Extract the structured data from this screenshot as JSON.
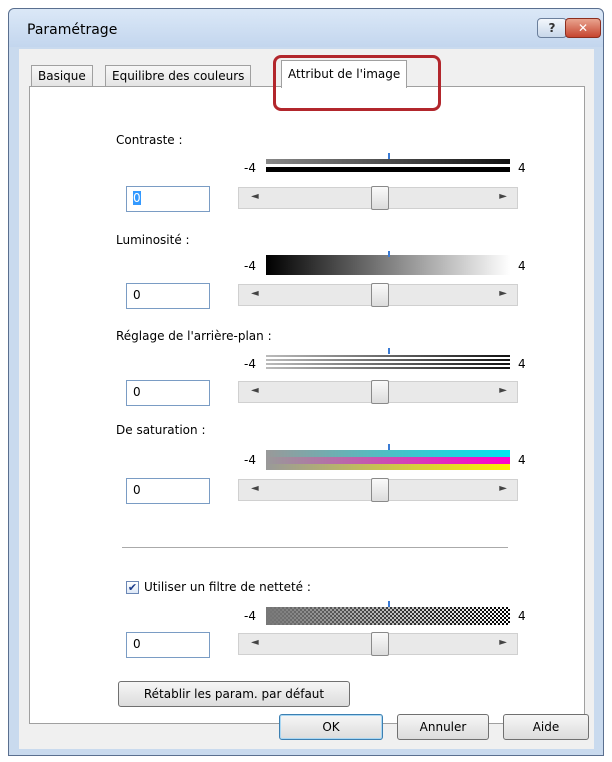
{
  "window": {
    "title": "Paramétrage",
    "help_glyph": "?",
    "close_glyph": "✕"
  },
  "tabs": [
    {
      "label": "Basique"
    },
    {
      "label": "Equilibre des couleurs"
    },
    {
      "label": "Attribut de l'image",
      "active": true
    }
  ],
  "ramp_min": "-4",
  "ramp_max": "4",
  "settings": [
    {
      "label": "Contraste :",
      "value": "0",
      "focused": true
    },
    {
      "label": "Luminosité :",
      "value": "0"
    },
    {
      "label": "Réglage de l'arrière-plan :",
      "value": "0"
    },
    {
      "label": "De saturation :",
      "value": "0"
    },
    {
      "label": "Utiliser un filtre de netteté :",
      "value": "0",
      "checked": true
    }
  ],
  "slider_arrows": {
    "left": "◄",
    "right": "►"
  },
  "check_mark": "✔",
  "reset_button": "Rétablir les param. par défaut",
  "footer": {
    "ok": "OK",
    "cancel": "Annuler",
    "help": "Aide"
  },
  "colors": {
    "highlight": "#b2262c",
    "focus": "#3399ff",
    "tick": "#3a7bd5"
  }
}
